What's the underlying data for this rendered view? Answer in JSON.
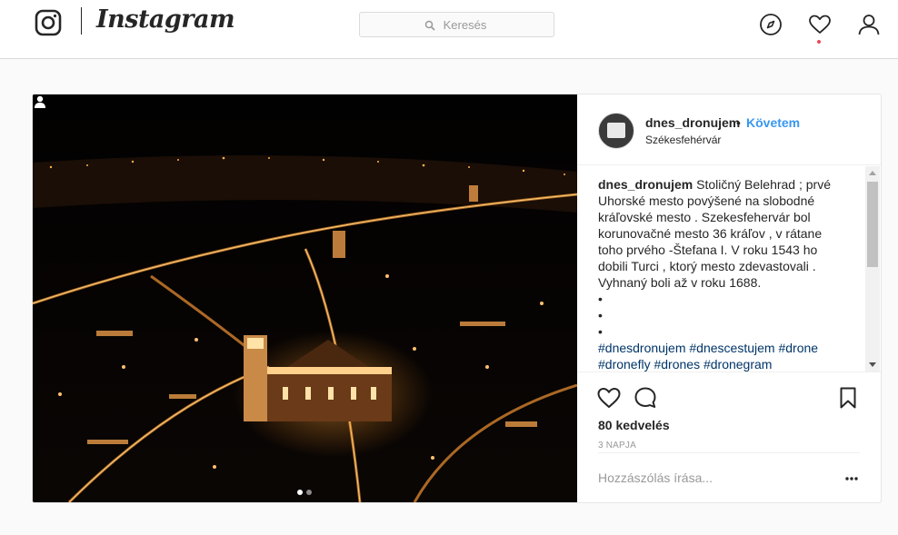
{
  "app": {
    "logo_text": "Instagram"
  },
  "search": {
    "placeholder": "Keresés"
  },
  "nav": {
    "icons": [
      "compass-icon",
      "heart-icon",
      "user-icon"
    ],
    "notification_dot_color": "#ed4956"
  },
  "post": {
    "username": "dnes_dronujem",
    "separator": "•",
    "follow_label": "Követem",
    "location": "Székesfehérvár",
    "caption": {
      "user": "dnes_dronujem",
      "text": "Stoličný Belehrad ; prvé Uhorské mesto povýšené na slobodné kráľovské mesto . Szekesfehervár bol korunovačné mesto 36 kráľov , v rátane toho prvého -Štefana I. V roku 1543 ho dobili Turci , ktorý mesto zdevastovali . Vyhnaný boli až v roku 1688.",
      "bullets": [
        "•",
        "•",
        "•"
      ],
      "hashtags_line1": "#dnesdronujem #dnescestujem #drone",
      "hashtags_line2": "#dronefly #drones #dronegram"
    },
    "likes": "80 kedvelés",
    "time": "3 NAPJA",
    "comment_placeholder": "Hozzászólás írása...",
    "carousel": {
      "count": 2,
      "active": 1
    }
  },
  "colors": {
    "link_blue": "#3897f0",
    "hashtag": "#003569",
    "border": "#dbdbdb",
    "bg": "#fafafa"
  }
}
